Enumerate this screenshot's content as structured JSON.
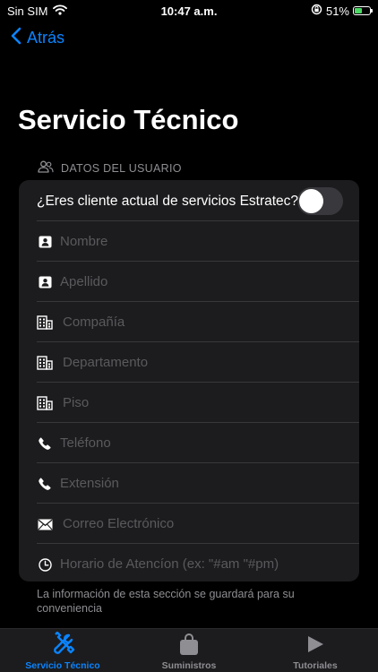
{
  "status_bar": {
    "carrier": "Sin SIM",
    "time": "10:47 a.m.",
    "battery": "51%",
    "battery_level": 0.51
  },
  "nav": {
    "back_label": "Atrás"
  },
  "page": {
    "title": "Servicio Técnico"
  },
  "section": {
    "header": "DATOS DEL USUARIO"
  },
  "form": {
    "toggle_label": "¿Eres cliente actual de servicios Estratec?",
    "toggle_on": false,
    "fields": [
      {
        "placeholder": "Nombre",
        "value": "",
        "icon": "contact-card-icon"
      },
      {
        "placeholder": "Apellido",
        "value": "",
        "icon": "contact-card-icon"
      },
      {
        "placeholder": "Compañía",
        "value": "",
        "icon": "building-icon"
      },
      {
        "placeholder": "Departamento",
        "value": "",
        "icon": "building-icon"
      },
      {
        "placeholder": "Piso",
        "value": "",
        "icon": "building-icon"
      },
      {
        "placeholder": "Teléfono",
        "value": "",
        "icon": "phone-icon"
      },
      {
        "placeholder": "Extensión",
        "value": "",
        "icon": "phone-icon"
      },
      {
        "placeholder": "Correo Electrónico",
        "value": "",
        "icon": "envelope-icon"
      },
      {
        "placeholder": "Horario de Atencíon (ex: \"#am \"#pm)",
        "value": "",
        "icon": "clock-icon"
      }
    ]
  },
  "footer": {
    "note": "La información de esta sección se guardará para su conveniencia"
  },
  "tabs": [
    {
      "label": "Servicio Técnico",
      "icon": "wrench-screwdriver-icon",
      "active": true
    },
    {
      "label": "Suministros",
      "icon": "shopping-bag-icon",
      "active": false
    },
    {
      "label": "Tutoriales",
      "icon": "play-icon",
      "active": false
    }
  ],
  "colors": {
    "accent": "#0a84ff",
    "card": "#1c1c1e",
    "background": "#000000",
    "placeholder": "#5a5a5e",
    "battery": "#4cd964"
  }
}
